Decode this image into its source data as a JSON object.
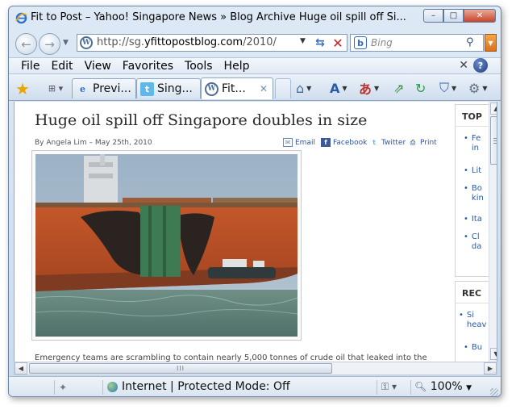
{
  "window": {
    "title": "Fit to Post – Yahoo! Singapore News » Blog Archive Huge oil spill off Si...",
    "caption_buttons": {
      "minimize": "–",
      "maximize": "□",
      "close": "✕"
    }
  },
  "address": {
    "url_prefix": "http://sg.",
    "url_domain": "yfittopostblog.com",
    "url_suffix": "/2010/",
    "search_placeholder": "Bing"
  },
  "menu": {
    "items": [
      "File",
      "Edit",
      "View",
      "Favorites",
      "Tools",
      "Help"
    ]
  },
  "tabs": [
    {
      "label": "Previ...",
      "icon": "ie-icon",
      "active": false
    },
    {
      "label": "Sing...",
      "icon": "twitter-icon",
      "active": false
    },
    {
      "label": "Fit...",
      "icon": "wordpress-icon",
      "active": true
    }
  ],
  "article": {
    "headline": "Huge oil spill off Singapore doubles in size",
    "byline": "By Angela Lim – May 25th, 2010",
    "share": [
      "Email",
      "Facebook",
      "Twitter",
      "Print"
    ],
    "lead": "Emergency teams are scrambling to contain nearly 5,000 tonnes of crude oil that leaked into the"
  },
  "sidebar": {
    "top_heading": "TOP",
    "top_items": [
      "Fe\nin",
      "Lit",
      "Bo\nkin",
      "Ita",
      "Cl\nda"
    ],
    "rec_heading": "REC",
    "rec_items": [
      "Si\nheav",
      "Bu"
    ]
  },
  "status": {
    "zone": "Internet | Protected Mode: Off",
    "zoom": "100%",
    "hscroll_grip": "III"
  },
  "colors": {
    "window_frame": "#c9dbee",
    "link_blue": "#2c5aa0",
    "search_dropdown": "#e88a2e"
  }
}
